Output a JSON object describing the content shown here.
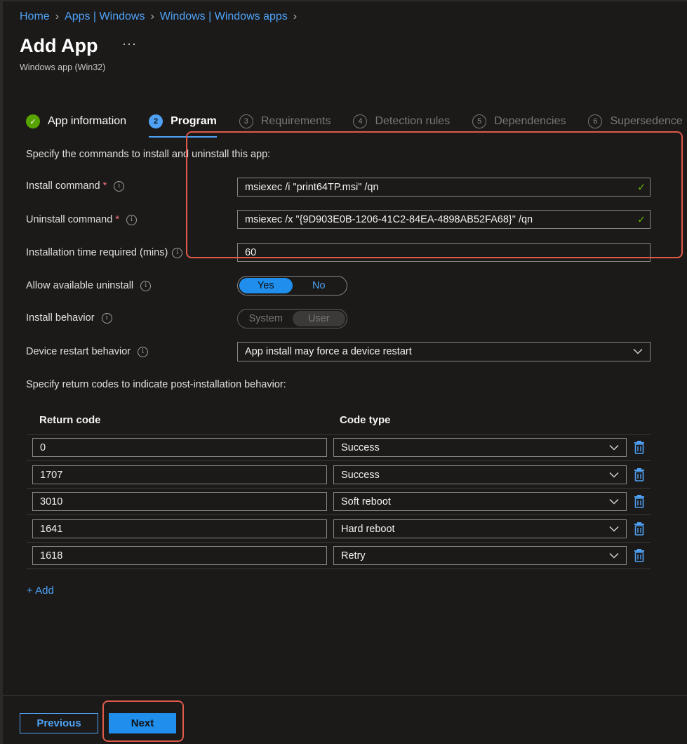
{
  "breadcrumb": [
    "Home",
    "Apps | Windows",
    "Windows | Windows apps"
  ],
  "title": "Add App",
  "subtitle": "Windows app (Win32)",
  "steps": [
    {
      "num": "✓",
      "label": "App information",
      "state": "done"
    },
    {
      "num": "2",
      "label": "Program",
      "state": "active"
    },
    {
      "num": "3",
      "label": "Requirements",
      "state": "pending"
    },
    {
      "num": "4",
      "label": "Detection rules",
      "state": "pending"
    },
    {
      "num": "5",
      "label": "Dependencies",
      "state": "pending"
    },
    {
      "num": "6",
      "label": "Supersedence",
      "state": "pending"
    }
  ],
  "form": {
    "intro": "Specify the commands to install and uninstall this app:",
    "install_label": "Install command",
    "install_value": "msiexec /i \"print64TP.msi\" /qn",
    "uninstall_label": "Uninstall command",
    "uninstall_value": "msiexec /x \"{9D903E0B-1206-41C2-84EA-4898AB52FA68}\" /qn",
    "time_label": "Installation time required (mins)",
    "time_value": "60",
    "allow_uninstall_label": "Allow available uninstall",
    "allow_yes": "Yes",
    "allow_no": "No",
    "behavior_label": "Install behavior",
    "behavior_system": "System",
    "behavior_user": "User",
    "restart_label": "Device restart behavior",
    "restart_value": "App install may force a device restart",
    "return_intro": "Specify return codes to indicate post-installation behavior:"
  },
  "table": {
    "col_code": "Return code",
    "col_type": "Code type",
    "rows": [
      {
        "code": "0",
        "type": "Success"
      },
      {
        "code": "1707",
        "type": "Success"
      },
      {
        "code": "3010",
        "type": "Soft reboot"
      },
      {
        "code": "1641",
        "type": "Hard reboot"
      },
      {
        "code": "1618",
        "type": "Retry"
      }
    ]
  },
  "add_label": "+ Add",
  "buttons": {
    "previous": "Previous",
    "next": "Next"
  },
  "colors": {
    "accent": "#4ea1f5",
    "highlight": "#e05a4a",
    "success": "#6bb700"
  }
}
